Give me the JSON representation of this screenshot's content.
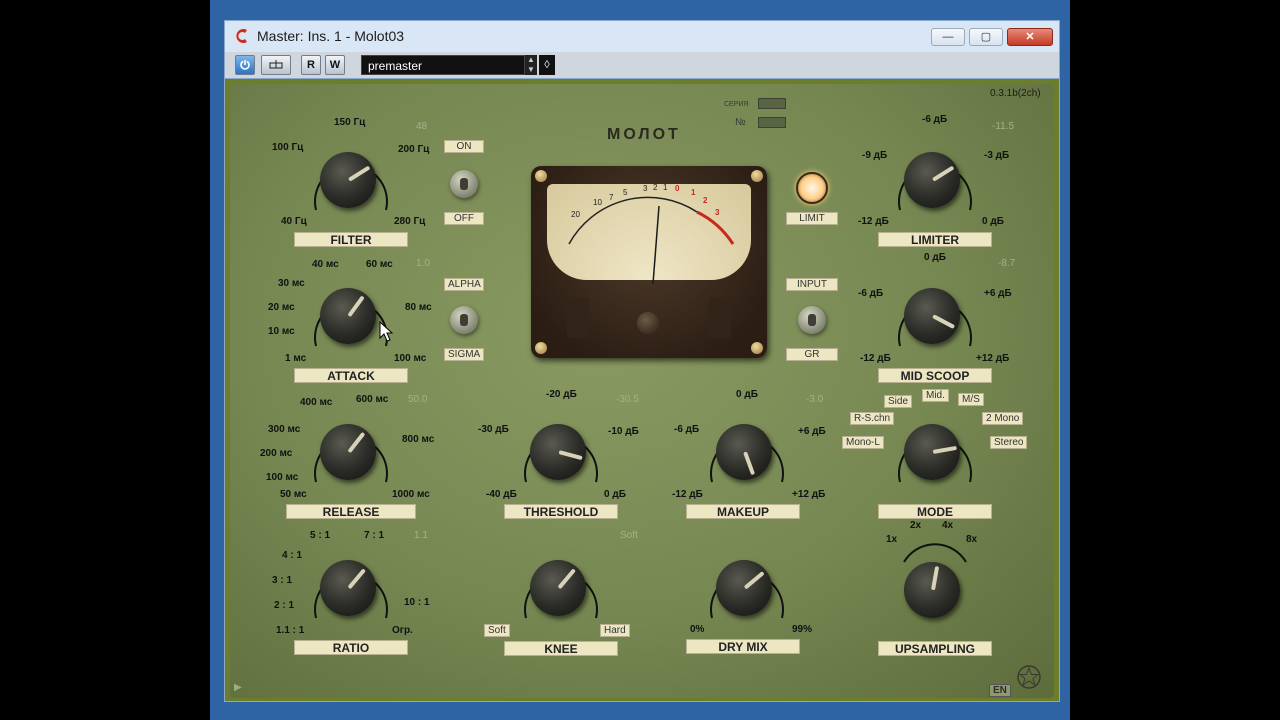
{
  "window": {
    "title": "Master: Ins. 1 - Molot03",
    "min_label": "—",
    "max_label": "▢",
    "close_label": "✕"
  },
  "toolbar": {
    "power_icon": "power-icon",
    "bypass_icon": "bypass-icon",
    "read_label": "R",
    "write_label": "W",
    "preset_value": "premaster"
  },
  "plugin": {
    "version": "0.3.1b(2ch)",
    "brand": "МОЛОТ",
    "series_label": "СЕРИЯ",
    "number_label": "№",
    "lang_button": "EN",
    "meter_scale": [
      "20",
      "10",
      "7",
      "5",
      "3",
      "2",
      "1",
      "0",
      "1",
      "2",
      "3"
    ]
  },
  "knobs": {
    "filter": {
      "name": "FILTER",
      "readout": "48",
      "labels": [
        "40 Гц",
        "100 Гц",
        "150 Гц",
        "200 Гц",
        "280 Гц"
      ]
    },
    "attack": {
      "name": "ATTACK",
      "readout": "1.0",
      "labels": [
        "1 мс",
        "10 мс",
        "20 мс",
        "30 мс",
        "40 мс",
        "60 мс",
        "80 мс",
        "100 мс"
      ]
    },
    "release": {
      "name": "RELEASE",
      "readout": "50.0",
      "labels": [
        "50 мс",
        "100 мс",
        "200 мс",
        "300 мс",
        "400 мс",
        "600 мс",
        "800 мс",
        "1000 мс"
      ]
    },
    "ratio": {
      "name": "RATIO",
      "readout": "1.1",
      "labels": [
        "1.1 : 1",
        "2 : 1",
        "3 : 1",
        "4 : 1",
        "5 : 1",
        "7 : 1",
        "10 : 1",
        "Огр."
      ]
    },
    "threshold": {
      "name": "THRESHOLD",
      "readout": "-30.5",
      "labels": [
        "-40 дБ",
        "-30 дБ",
        "-20 дБ",
        "-10 дБ",
        "0 дБ"
      ]
    },
    "knee": {
      "name": "KNEE",
      "readout": "Soft",
      "labels": [
        "Soft",
        "Hard"
      ]
    },
    "makeup": {
      "name": "MAKEUP",
      "readout": "-3.0",
      "labels": [
        "-12 дБ",
        "-6 дБ",
        "0 дБ",
        "+6 дБ",
        "+12 дБ"
      ]
    },
    "drymix": {
      "name": "DRY MIX",
      "labels": [
        "0%",
        "99%"
      ]
    },
    "limiter": {
      "name": "LIMITER",
      "readout": "-11.5",
      "labels": [
        "-12 дБ",
        "-9 дБ",
        "-6 дБ",
        "-3 дБ",
        "0 дБ"
      ]
    },
    "midscoop": {
      "name": "MID SCOOP",
      "readout": "-8.7",
      "labels": [
        "-12 дБ",
        "-6 дБ",
        "0 дБ",
        "+6 дБ",
        "+12 дБ"
      ]
    },
    "mode": {
      "name": "MODE",
      "labels": [
        "Mono-L",
        "R-S.chn",
        "Side",
        "Mid.",
        "M/S",
        "2 Mono",
        "Stereo"
      ]
    },
    "upsampling": {
      "name": "UPSAMPLING",
      "labels": [
        "1x",
        "2x",
        "4x",
        "8x"
      ]
    }
  },
  "switches": {
    "onoff": {
      "top": "ON",
      "bottom": "OFF"
    },
    "alphasigma": {
      "top": "ALPHA",
      "bottom": "SIGMA"
    },
    "limit_label": "LIMIT",
    "input_gr": {
      "top": "INPUT",
      "bottom": "GR"
    }
  }
}
